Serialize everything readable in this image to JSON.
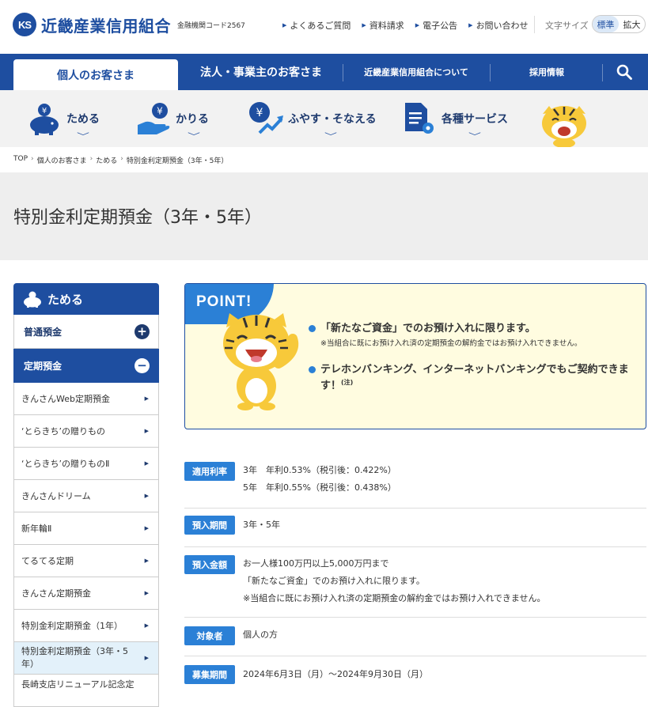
{
  "header": {
    "logo_mark": "KS",
    "bank_name": "近畿産業信用組合",
    "bank_code": "金融機関コード2567",
    "util_links": [
      "よくあるご質問",
      "資料請求",
      "電子公告",
      "お問い合わせ"
    ],
    "font_size_label": "文字サイズ",
    "font_options": [
      "標準",
      "拡大"
    ]
  },
  "mainnav": {
    "tabs": [
      "個人のお客さま",
      "法人・事業主のお客さま",
      "近畿産業信用組合について",
      "採用情報"
    ]
  },
  "categories": [
    "ためる",
    "かりる",
    "ふやす・そなえる",
    "各種サービス"
  ],
  "breadcrumb": [
    "TOP",
    "個人のお客さま",
    "ためる",
    "特別金利定期預金（3年・5年）"
  ],
  "page_title": "特別金利定期預金（3年・5年）",
  "sidebar": {
    "heading": "ためる",
    "sections": [
      {
        "label": "普通預金",
        "toggle": "+"
      },
      {
        "label": "定期預金",
        "toggle": "−"
      }
    ],
    "items": [
      "きんさんWeb定期預金",
      "‘とらきち’の贈りもの",
      "‘とらきち’の贈りものⅡ",
      "きんさんドリーム",
      "新年輪Ⅱ",
      "てるてる定期",
      "きんさん定期預金",
      "特別金利定期預金（1年）",
      "特別金利定期預金（3年・5年）",
      "長崎支店リニューアル記念定"
    ]
  },
  "point": {
    "badge": "POINT!",
    "bullet1": "「新たなご資金」でのお預け入れに限ります。",
    "bullet1_note": "※当組合に既にお預け入れ済の定期預金の解約金ではお預け入れできません。",
    "bullet2": "テレホンバンキング、インターネットバンキングでもご契約できます！",
    "bullet2_sup": "(注)"
  },
  "details": [
    {
      "label": "適用利率",
      "lines": [
        "3年　年利0.53%（税引後：0.422%）",
        "5年　年利0.55%（税引後：0.438%）"
      ]
    },
    {
      "label": "預入期間",
      "lines": [
        "3年・5年"
      ]
    },
    {
      "label": "預入金額",
      "lines": [
        "お一人様100万円以上5,000万円まで",
        "「新たなご資金」でのお預け入れに限ります。",
        "※当組合に既にお預け入れ済の定期預金の解約金ではお預け入れできません。"
      ]
    },
    {
      "label": "対象者",
      "lines": [
        "個人の方"
      ]
    },
    {
      "label": "募集期間",
      "lines": [
        "2024年6月3日（月）～2024年9月30日（月）"
      ]
    }
  ],
  "colors": {
    "brand": "#1e4ea0",
    "accent": "#2b80d6",
    "point_bg": "#fffce0",
    "current_item_bg": "#e3f1fa"
  }
}
